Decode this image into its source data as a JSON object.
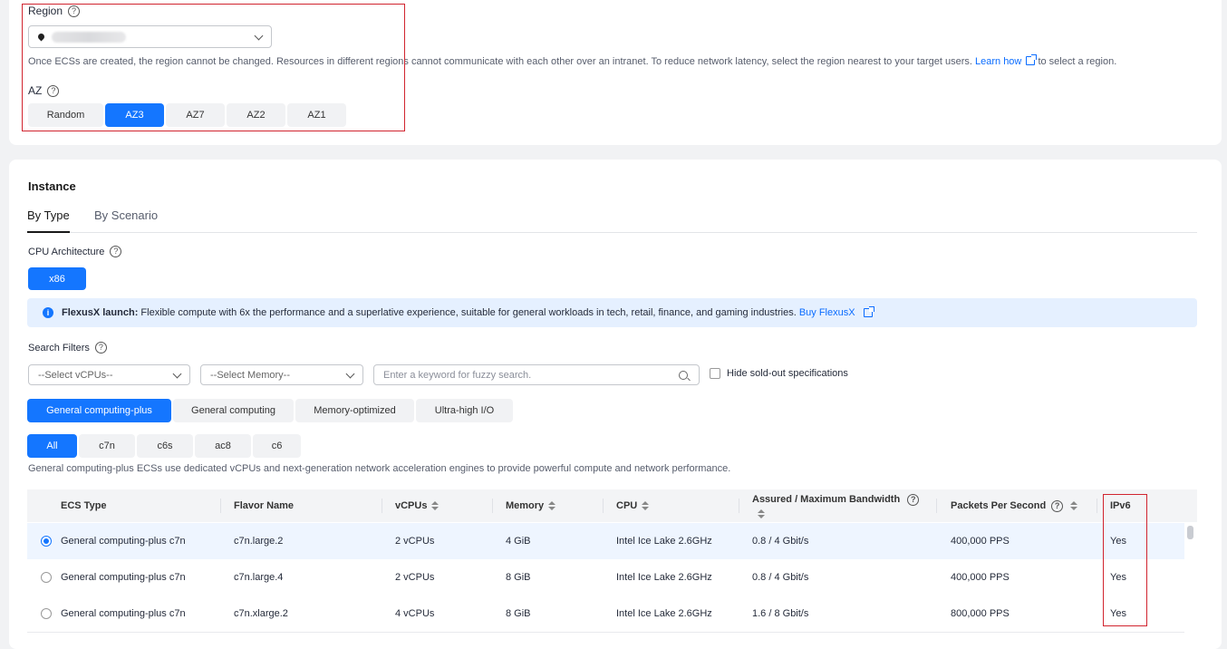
{
  "region": {
    "label": "Region",
    "help": "?",
    "description": "Once ECSs are created, the region cannot be changed. Resources in different regions cannot communicate with each other over an intranet. To reduce network latency, select the region nearest to your target users.",
    "learn_how": "Learn how",
    "after_link": "to select a region."
  },
  "az": {
    "label": "AZ",
    "help": "?",
    "options": [
      "Random",
      "AZ3",
      "AZ7",
      "AZ2",
      "AZ1"
    ],
    "selected": "AZ3"
  },
  "instance": {
    "title": "Instance",
    "tabs": [
      "By Type",
      "By Scenario"
    ],
    "active_tab": "By Type",
    "cpu_arch_label": "CPU Architecture",
    "cpu_arch_help": "?",
    "cpu_arch": "x86",
    "banner": {
      "icon": "info-icon",
      "strong": "FlexusX launch:",
      "text": "Flexible compute with 6x the performance and a superlative experience, suitable for general workloads in tech, retail, finance, and gaming industries.",
      "link": "Buy FlexusX"
    },
    "filters": {
      "label": "Search Filters",
      "help": "?",
      "vcpu_placeholder": "--Select vCPUs--",
      "memory_placeholder": "--Select Memory--",
      "search_placeholder": "Enter a keyword for fuzzy search.",
      "hide_sold_out": "Hide sold-out specifications"
    },
    "categories": [
      "General computing-plus",
      "General computing",
      "Memory-optimized",
      "Ultra-high I/O"
    ],
    "active_category": "General computing-plus",
    "families": [
      "All",
      "c7n",
      "c6s",
      "ac8",
      "c6"
    ],
    "active_family": "All",
    "family_description": "General computing-plus ECSs use dedicated vCPUs and next-generation network acceleration engines to provide powerful compute and network performance."
  },
  "table": {
    "columns": {
      "ecs_type": "ECS Type",
      "flavor": "Flavor Name",
      "vcpus": "vCPUs",
      "memory": "Memory",
      "cpu": "CPU",
      "bandwidth": "Assured / Maximum Bandwidth",
      "pps": "Packets Per Second",
      "help": "?",
      "ipv6": "IPv6"
    },
    "rows": [
      {
        "selected": true,
        "ecs_type": "General computing-plus c7n",
        "flavor": "c7n.large.2",
        "vcpus": "2 vCPUs",
        "memory": "4 GiB",
        "cpu": "Intel Ice Lake 2.6GHz",
        "bandwidth": "0.8 / 4 Gbit/s",
        "pps": "400,000 PPS",
        "ipv6": "Yes"
      },
      {
        "selected": false,
        "ecs_type": "General computing-plus c7n",
        "flavor": "c7n.large.4",
        "vcpus": "2 vCPUs",
        "memory": "8 GiB",
        "cpu": "Intel Ice Lake 2.6GHz",
        "bandwidth": "0.8 / 4 Gbit/s",
        "pps": "400,000 PPS",
        "ipv6": "Yes"
      },
      {
        "selected": false,
        "ecs_type": "General computing-plus c7n",
        "flavor": "c7n.xlarge.2",
        "vcpus": "4 vCPUs",
        "memory": "8 GiB",
        "cpu": "Intel Ice Lake 2.6GHz",
        "bandwidth": "1.6 / 8 Gbit/s",
        "pps": "800,000 PPS",
        "ipv6": "Yes"
      }
    ]
  },
  "colors": {
    "accent": "#1476ff",
    "highlight_border": "#d1242f",
    "banner_bg": "#e5f0ff"
  }
}
